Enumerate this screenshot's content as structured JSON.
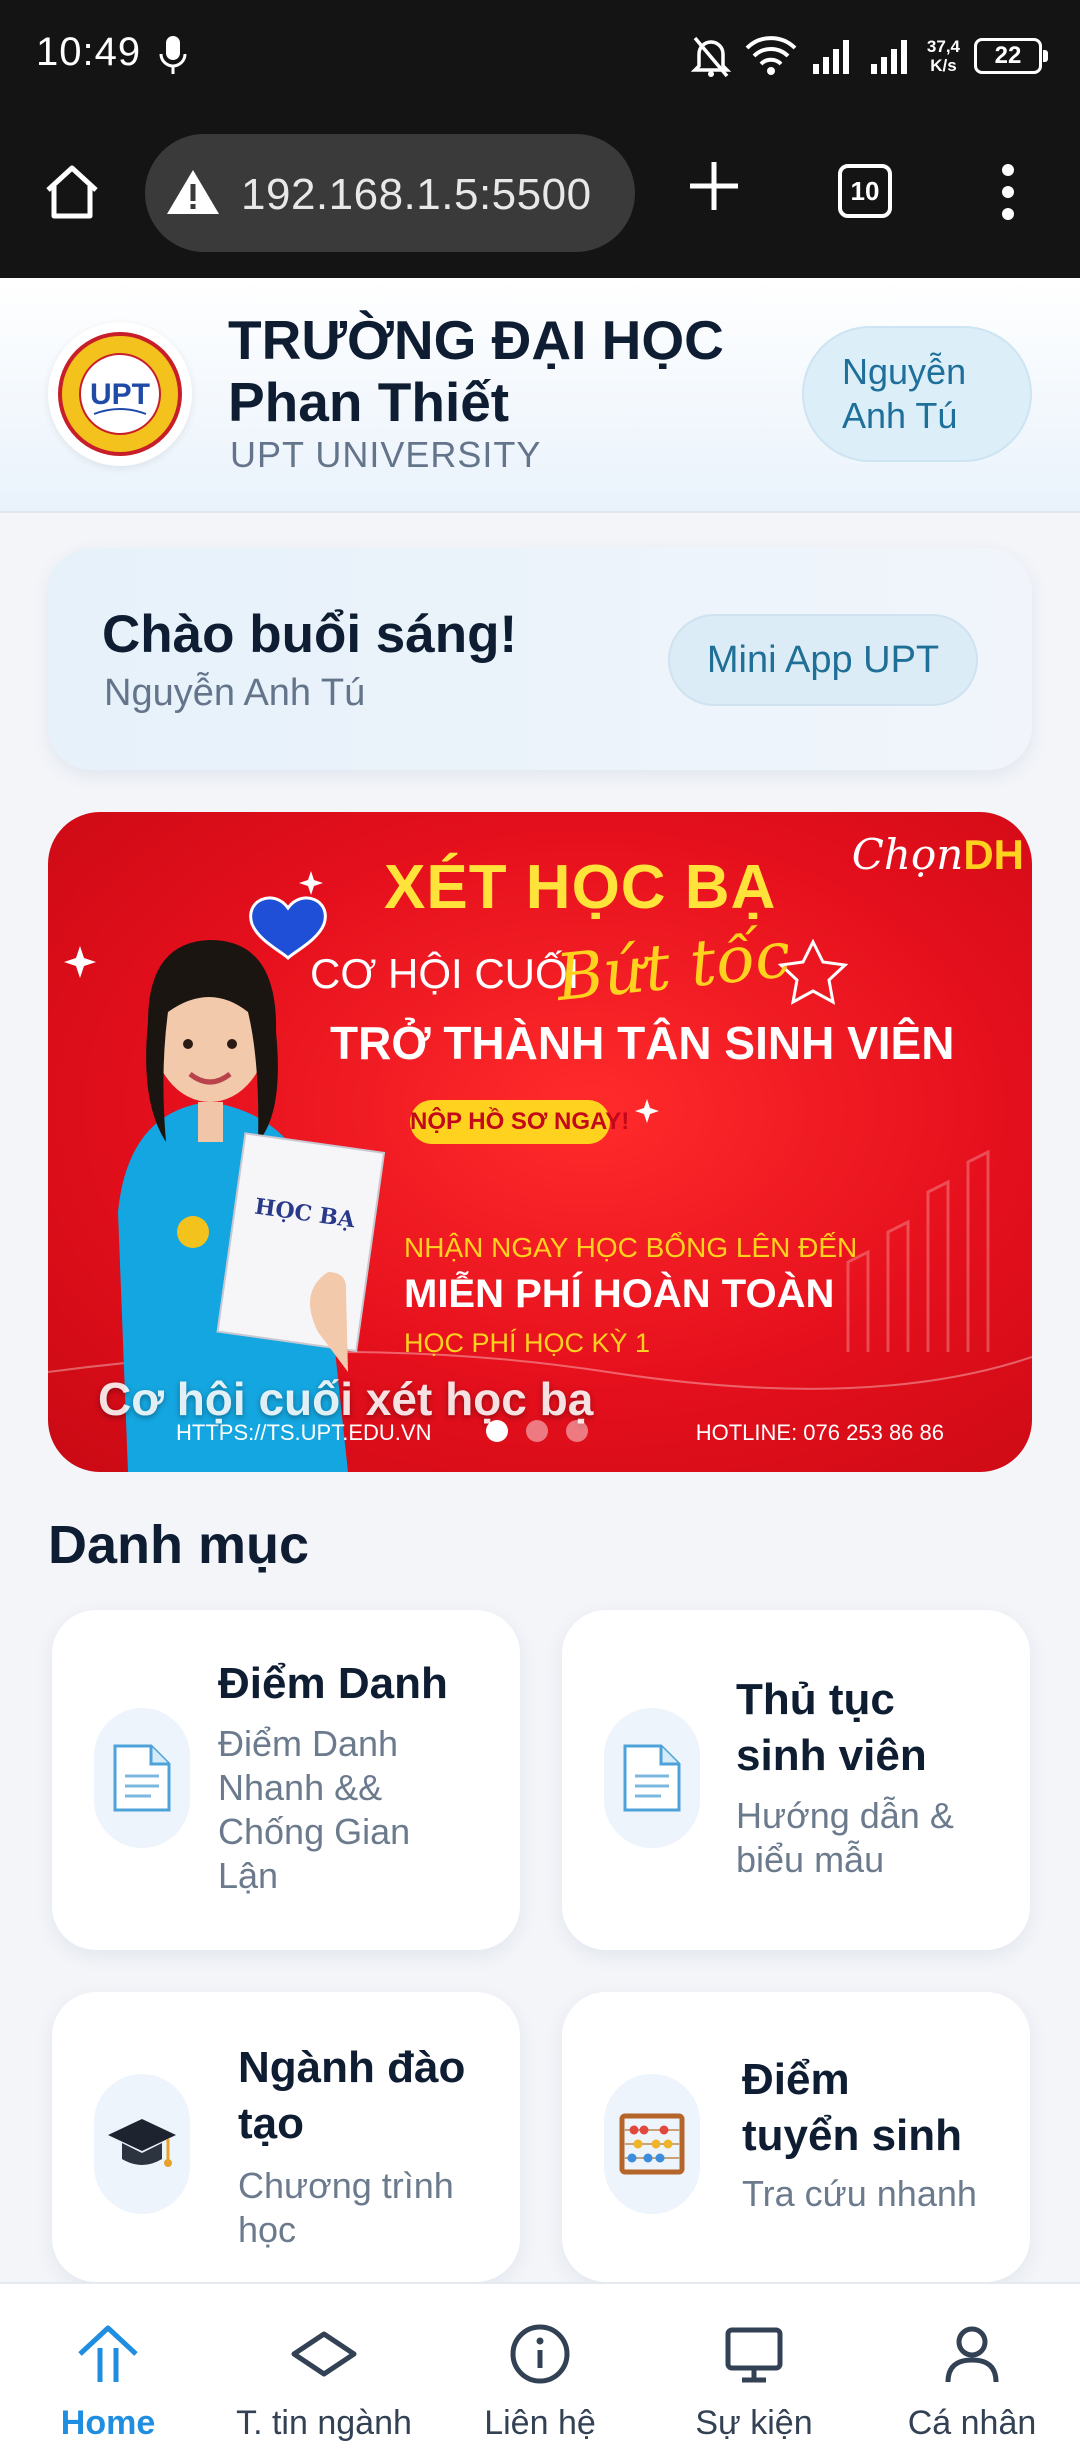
{
  "status_bar": {
    "time": "10:49",
    "net_speed_value": "37,4",
    "net_speed_unit": "K/s",
    "battery": "22"
  },
  "browser": {
    "url": "192.168.1.5:5500",
    "tab_count": "10"
  },
  "header": {
    "name_line1": "TRƯỜNG ĐẠI HỌC",
    "name_line2": "Phan Thiết",
    "subtitle": "UPT UNIVERSITY",
    "user_line1": "Nguyễn",
    "user_line2": "Anh Tú",
    "logo_text": "UPT"
  },
  "greeting": {
    "title": "Chào buổi sáng!",
    "name": "Nguyễn Anh Tú",
    "button": "Mini App UPT"
  },
  "banner": {
    "headline": "XÉT HỌC BẠ",
    "line2": "CƠ HỘI CUỐI",
    "script": "Bứt tốc",
    "line3": "TRỞ THÀNH TÂN SINH VIÊN",
    "pill": "NỘP HỒ SƠ NGAY!",
    "line4": "NHẬN NGAY HỌC BỔNG LÊN ĐẾN",
    "line5": "MIỄN PHÍ HOÀN TOÀN",
    "line6": "HỌC PHÍ HỌC KỲ 1",
    "brand_prefix": "Chọn",
    "brand_suffix": "DH",
    "url": "HTTPS://TS.UPT.EDU.VN",
    "hotline": "HOTLINE: 076 253 86 86",
    "caption": "Cơ hội cuối xét học bạ",
    "book_title": "HỌC BẠ",
    "slide_count": 3,
    "active_slide": 0
  },
  "categories": {
    "title": "Danh mục",
    "items": [
      {
        "icon": "document-icon",
        "title_lines": [
          "Điểm Danh"
        ],
        "desc_lines": [
          "Điểm Danh",
          "Nhanh &&",
          "Chống Gian",
          "Lận"
        ]
      },
      {
        "icon": "document-icon",
        "title_lines": [
          "Thủ tục",
          "sinh viên"
        ],
        "desc_lines": [
          "Hướng dẫn &",
          "biểu mẫu"
        ]
      },
      {
        "icon": "graduation-cap-icon",
        "title_lines": [
          "Ngành đào",
          "tạo"
        ],
        "desc_lines": [
          "Chương trình",
          "học"
        ]
      },
      {
        "icon": "abacus-icon",
        "title_lines": [
          "Điểm",
          "tuyển sinh"
        ],
        "desc_lines": [
          "Tra cứu nhanh"
        ]
      }
    ]
  },
  "bottom_nav": {
    "active_color": "#1f8de0",
    "items": [
      {
        "label": "Home",
        "icon": "home-icon",
        "active": true
      },
      {
        "label": "T. tin ngành",
        "icon": "diamond-icon",
        "active": false
      },
      {
        "label": "Liên hệ",
        "icon": "info-icon",
        "active": false
      },
      {
        "label": "Sự kiện",
        "icon": "monitor-icon",
        "active": false
      },
      {
        "label": "Cá nhân",
        "icon": "user-icon",
        "active": false
      }
    ]
  }
}
